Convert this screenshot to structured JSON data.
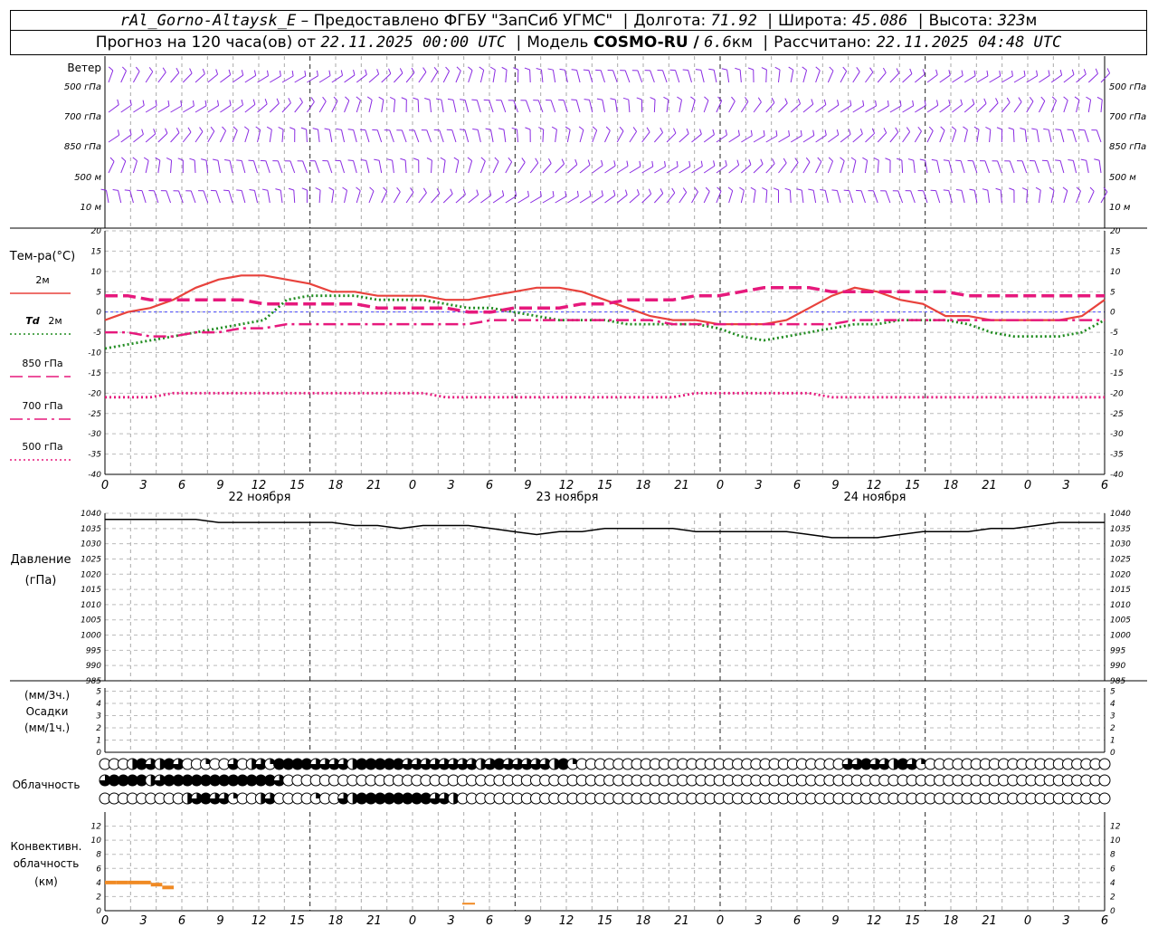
{
  "header": {
    "station": "rAl_Gorno-Altaysk_E",
    "provided": "– Предоставлено ФГБУ \"ЗапСиб УГМС\"",
    "lon_label": "Долгота:",
    "lon": "71.92",
    "lat_label": "Широта:",
    "lat": "45.086",
    "alt_label": "Высота:",
    "alt": "323",
    "alt_unit": "м",
    "forecast_label": "Прогноз на 120 часа(ов) от",
    "forecast_start": "22.11.2025 00:00 UTC",
    "model_label": "Модель",
    "model": "COSMO-RU /",
    "resolution": "6.6",
    "res_unit": "км",
    "calc_label": "Рассчитано:",
    "calc_time": "22.11.2025 04:48 UTC"
  },
  "chart_data": [
    {
      "type": "line",
      "panel": "wind",
      "title": "Ветер",
      "levels": [
        "500 гПа",
        "700 гПа",
        "850 гПа",
        "500 м",
        "10 м"
      ],
      "color": "#8a2be2"
    },
    {
      "type": "line",
      "panel": "temperature",
      "ylabel": "Тем-ра(°C)",
      "ylim": [
        -40,
        20
      ],
      "yticks": [
        20,
        15,
        10,
        5,
        0,
        -5,
        -10,
        -15,
        -20,
        -25,
        -30,
        -35,
        -40
      ],
      "x_hours_step": 3,
      "xtick_labels": [
        "0",
        "3",
        "6",
        "9",
        "12",
        "15",
        "18",
        "21",
        "0",
        "3",
        "6",
        "9",
        "12",
        "15",
        "18",
        "21",
        "0",
        "3",
        "6",
        "9",
        "12",
        "15",
        "18",
        "21",
        "0",
        "3",
        "6"
      ],
      "day_labels": [
        "22 ноября",
        "23 ноября",
        "24 ноября"
      ],
      "series": [
        {
          "name": "2м",
          "color": "#e8423c",
          "style": "solid",
          "values": [
            -2,
            0,
            1,
            3,
            6,
            8,
            9,
            9,
            8,
            7,
            5,
            5,
            4,
            4,
            4,
            3,
            3,
            4,
            5,
            6,
            6,
            5,
            3,
            1,
            -1,
            -2,
            -2,
            -3,
            -3,
            -3,
            -2,
            1,
            4,
            6,
            5,
            3,
            2,
            -1,
            -1,
            -2,
            -2,
            -2,
            -2,
            -1,
            3
          ]
        },
        {
          "name": "2м",
          "prefix": "Td",
          "color": "#1f8b1f",
          "style": "dotted",
          "values": [
            -9,
            -8,
            -7,
            -6,
            -5,
            -4,
            -3,
            -2,
            3,
            4,
            4,
            4,
            3,
            3,
            3,
            2,
            1,
            1,
            0,
            -1,
            -2,
            -2,
            -2,
            -3,
            -3,
            -3,
            -3,
            -4,
            -6,
            -7,
            -6,
            -5,
            -4,
            -3,
            -3,
            -2,
            -2,
            -2,
            -3,
            -5,
            -6,
            -6,
            -6,
            -5,
            -2
          ]
        },
        {
          "name": "850 гПа",
          "color": "#e6197c",
          "style": "dashed",
          "values": [
            4,
            4,
            3,
            3,
            3,
            3,
            3,
            2,
            2,
            2,
            2,
            2,
            1,
            1,
            1,
            1,
            0,
            0,
            1,
            1,
            1,
            2,
            2,
            3,
            3,
            3,
            4,
            4,
            5,
            6,
            6,
            6,
            5,
            5,
            5,
            5,
            5,
            5,
            4,
            4,
            4,
            4,
            4,
            4,
            4
          ]
        },
        {
          "name": "700 гПа",
          "color": "#e6197c",
          "style": "dashdot",
          "values": [
            -5,
            -5,
            -6,
            -6,
            -5,
            -5,
            -4,
            -4,
            -3,
            -3,
            -3,
            -3,
            -3,
            -3,
            -3,
            -3,
            -3,
            -2,
            -2,
            -2,
            -2,
            -2,
            -2,
            -2,
            -2,
            -3,
            -3,
            -3,
            -3,
            -3,
            -3,
            -3,
            -3,
            -2,
            -2,
            -2,
            -2,
            -2,
            -2,
            -2,
            -2,
            -2,
            -2,
            -2,
            -2
          ]
        },
        {
          "name": "500 гПа",
          "color": "#e6197c",
          "style": "dotted",
          "values": [
            -21,
            -21,
            -21,
            -20,
            -20,
            -20,
            -20,
            -20,
            -20,
            -20,
            -20,
            -20,
            -20,
            -20,
            -20,
            -21,
            -21,
            -21,
            -21,
            -21,
            -21,
            -21,
            -21,
            -21,
            -21,
            -21,
            -20,
            -20,
            -20,
            -20,
            -20,
            -20,
            -21,
            -21,
            -21,
            -21,
            -21,
            -21,
            -21,
            -21,
            -21,
            -21,
            -21,
            -21,
            -21
          ]
        }
      ]
    },
    {
      "type": "line",
      "panel": "pressure",
      "ylabel": "Давление",
      "yunit": "(гПа)",
      "ylim": [
        985,
        1040
      ],
      "yticks": [
        1040,
        1035,
        1030,
        1025,
        1020,
        1015,
        1010,
        1005,
        1000,
        995,
        990,
        985
      ],
      "series": [
        {
          "name": "",
          "color": "#000000",
          "values": [
            1038,
            1038,
            1038,
            1038,
            1038,
            1037,
            1037,
            1037,
            1037,
            1037,
            1037,
            1036,
            1036,
            1035,
            1036,
            1036,
            1036,
            1035,
            1034,
            1033,
            1034,
            1034,
            1035,
            1035,
            1035,
            1035,
            1034,
            1034,
            1034,
            1034,
            1034,
            1033,
            1032,
            1032,
            1032,
            1033,
            1034,
            1034,
            1034,
            1035,
            1035,
            1036,
            1037,
            1037,
            1037
          ]
        }
      ]
    },
    {
      "type": "bar",
      "panel": "precipitation",
      "title": "Осадки",
      "ylabel_top": "(мм/3ч.)",
      "ylabel_bottom": "(мм/1ч.)",
      "ylim": [
        0,
        5
      ],
      "yticks": [
        5,
        4,
        3,
        2,
        1,
        0
      ],
      "values": []
    },
    {
      "type": "table",
      "panel": "cloudiness",
      "title": "Облачность",
      "columns": 45,
      "rows": [
        {
          "cells": [
            0,
            0,
            0,
            2,
            4,
            3,
            2,
            4,
            3,
            0,
            0,
            1,
            0,
            0,
            3,
            0,
            2,
            3,
            1,
            4,
            4,
            4,
            4,
            3,
            3,
            3,
            3,
            2,
            4,
            4,
            4,
            4,
            4,
            3,
            3,
            3,
            3,
            3,
            3,
            3,
            3,
            2,
            3,
            4,
            3,
            3,
            3,
            3,
            3,
            2,
            4,
            1,
            0,
            0,
            0,
            0,
            0,
            0,
            0,
            0,
            0,
            0,
            0,
            0,
            0,
            0,
            0,
            0,
            0,
            0,
            0,
            0,
            0,
            0,
            0,
            0,
            0,
            0,
            0,
            0,
            0,
            3,
            3,
            4,
            3,
            3,
            2,
            4,
            3,
            1,
            0,
            0,
            0,
            0,
            0,
            0,
            0,
            0,
            0,
            0,
            0,
            0,
            0,
            0,
            0,
            0,
            0,
            0,
            0,
            0
          ]
        },
        {
          "cells": [
            3,
            4,
            4,
            4,
            4,
            2,
            3,
            4,
            4,
            4,
            4,
            4,
            4,
            4,
            4,
            4,
            4,
            4,
            4,
            3,
            0,
            0,
            0,
            0,
            0,
            0,
            0,
            0,
            0,
            0,
            0,
            0,
            0,
            0,
            0,
            0,
            0,
            0,
            0,
            0,
            0,
            0,
            0,
            0,
            0,
            0,
            0,
            0,
            0,
            0,
            0,
            0,
            0,
            0,
            0,
            0,
            0,
            0,
            0,
            0,
            0,
            0,
            0,
            0,
            0,
            0,
            0,
            0,
            0,
            0,
            0,
            0,
            0,
            0,
            0,
            0,
            0,
            0,
            0,
            0,
            0,
            0,
            0,
            0,
            0,
            0,
            0,
            0,
            0,
            0,
            0,
            0,
            0,
            0,
            0,
            0,
            0,
            0,
            0,
            0,
            0,
            0,
            0,
            0,
            0,
            0,
            0,
            0,
            0,
            0
          ]
        },
        {
          "cells": [
            0,
            0,
            0,
            0,
            0,
            0,
            0,
            0,
            0,
            2,
            3,
            4,
            3,
            3,
            1,
            0,
            0,
            2,
            3,
            0,
            0,
            0,
            0,
            1,
            0,
            0,
            3,
            2,
            4,
            4,
            4,
            4,
            4,
            4,
            4,
            4,
            3,
            3,
            2,
            0,
            0,
            0,
            0,
            0,
            0,
            0,
            0,
            0,
            0,
            0,
            0,
            0,
            0,
            0,
            0,
            0,
            0,
            0,
            0,
            0,
            0,
            0,
            0,
            0,
            0,
            0,
            0,
            0,
            0,
            0,
            0,
            0,
            0,
            0,
            0,
            0,
            0,
            0,
            0,
            0,
            0,
            0,
            0,
            0,
            0,
            0,
            0,
            0,
            0,
            0,
            0,
            0,
            0,
            0,
            0,
            0,
            0,
            0,
            0,
            0,
            0,
            0,
            0,
            0,
            0,
            0,
            0,
            0,
            0,
            0
          ]
        }
      ]
    },
    {
      "type": "bar",
      "panel": "convective",
      "ylabel": "Конвективн. облачность",
      "yunit": "(км)",
      "ylim": [
        0,
        14
      ],
      "yticks": [
        12,
        10,
        8,
        6,
        4,
        2,
        0
      ],
      "color": "#f08a24",
      "values": [
        4,
        4,
        4,
        4,
        3.7,
        3.3
      ]
    }
  ]
}
